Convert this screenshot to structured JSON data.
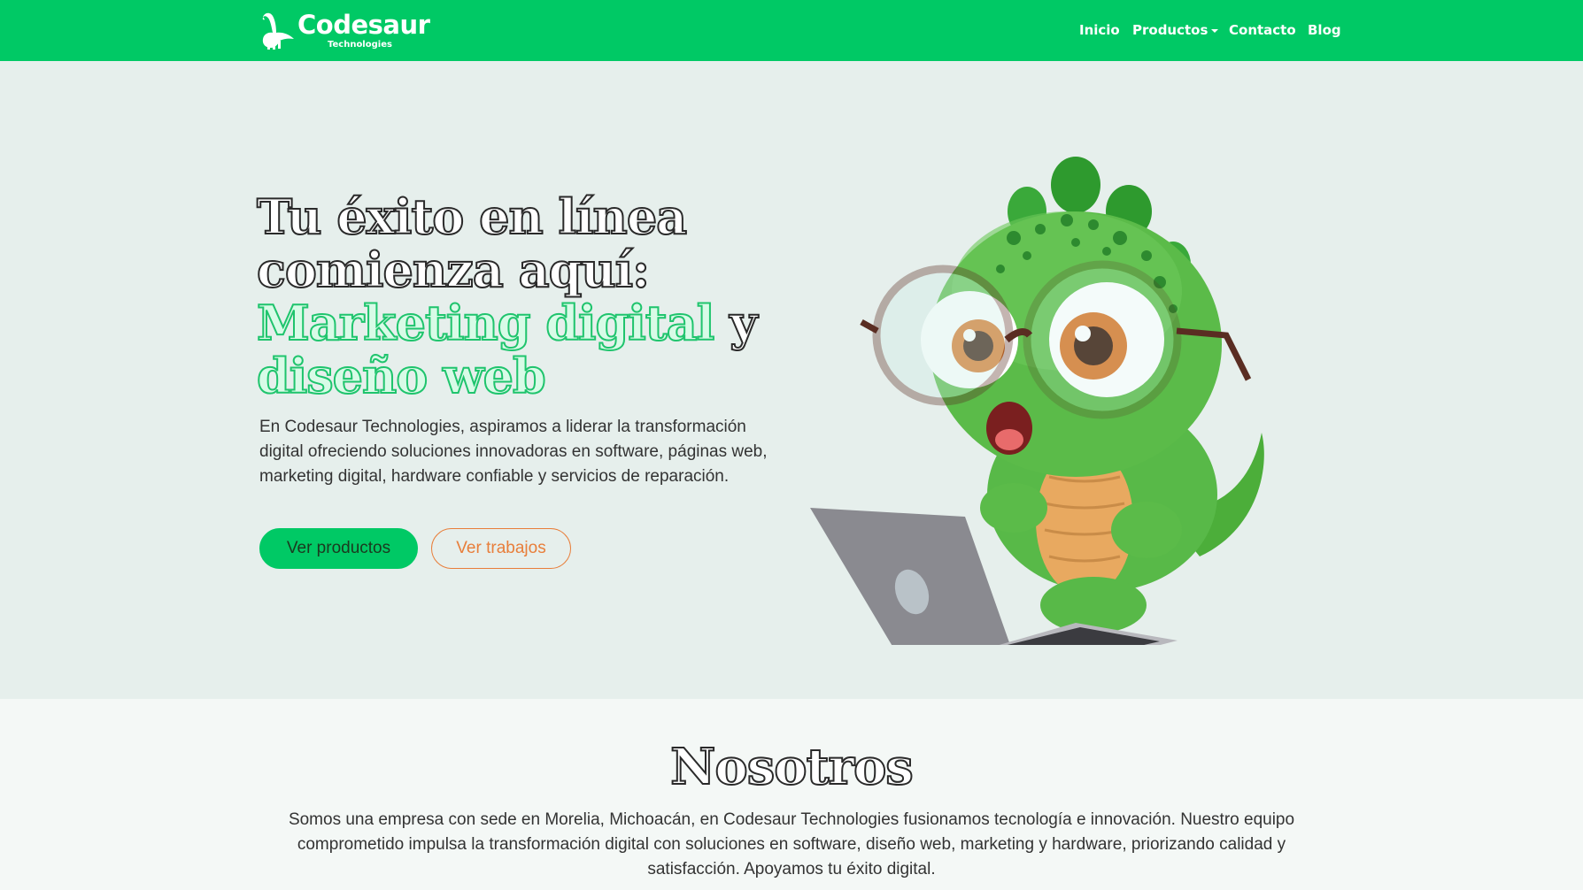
{
  "brand": {
    "name": "Codesaur",
    "subtitle": "Technologies",
    "colors": {
      "primary": "#00c965",
      "accent": "#e87e3a",
      "hero_bg": "#e6efec"
    }
  },
  "nav": {
    "items": [
      {
        "label": "Inicio"
      },
      {
        "label": "Productos",
        "icon": "chevron-down-icon"
      },
      {
        "label": "Contacto"
      },
      {
        "label": "Blog"
      }
    ]
  },
  "hero": {
    "title_line1": "Tu éxito en línea",
    "title_line2": "comienza aquí:",
    "title_highlight1": "Marketing digital",
    "title_connector": "y",
    "title_highlight2": "diseño web",
    "description": "En Codesaur Technologies, aspiramos a liderar la transformación digital ofreciendo soluciones innovadoras en software, páginas web, marketing digital, hardware confiable y servicios de reparación.",
    "primary_button": "Ver productos",
    "secondary_button": "Ver trabajos",
    "image_icon": "dinosaur-mascot-with-laptop"
  },
  "about": {
    "title": "Nosotros",
    "text": "Somos una empresa con sede en Morelia, Michoacán, en Codesaur Technologies fusionamos tecnología e innovación. Nuestro equipo comprometido impulsa la transformación digital con soluciones en software, diseño web, marketing y hardware, priorizando calidad y satisfacción. Apoyamos tu éxito digital."
  }
}
